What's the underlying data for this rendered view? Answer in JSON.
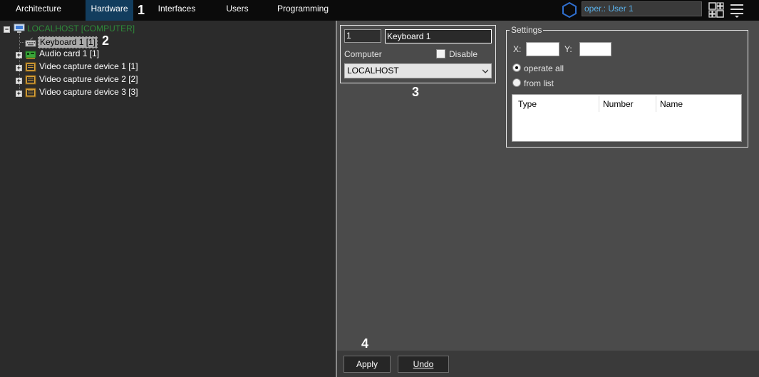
{
  "topbar": {
    "tabs": [
      {
        "label": "Architecture",
        "active": false
      },
      {
        "label": "Hardware",
        "active": true
      },
      {
        "label": "Interfaces",
        "active": false
      },
      {
        "label": "Users",
        "active": false
      },
      {
        "label": "Programming",
        "active": false
      }
    ],
    "user_field": "oper.: User 1",
    "icons": [
      "hexagon-icon",
      "layout-grid-icon",
      "menu-icon"
    ]
  },
  "markers": [
    "1",
    "2",
    "3",
    "4"
  ],
  "tree": {
    "root": "LOCALHOST [COMPUTER]",
    "items": [
      {
        "label": "Keyboard 1 [1]",
        "icon": "keyboard-icon",
        "selected": true
      },
      {
        "label": "Audio card 1 [1]",
        "icon": "audio-card-icon",
        "selected": false
      },
      {
        "label": "Video capture device 1 [1]",
        "icon": "video-capture-icon",
        "selected": false
      },
      {
        "label": "Video capture device 2 [2]",
        "icon": "video-capture-icon",
        "selected": false
      },
      {
        "label": "Video capture device 3 [3]",
        "icon": "video-capture-icon",
        "selected": false
      }
    ]
  },
  "device": {
    "number": "1",
    "name": "Keyboard 1",
    "computer_label": "Computer",
    "disable_label": "Disable",
    "disable_checked": false,
    "computer_value": "LOCALHOST"
  },
  "settings": {
    "legend": "Settings",
    "x_label": "X:",
    "y_label": "Y:",
    "x_value": "",
    "y_value": "",
    "radio_operate_all": "operate all",
    "radio_from_list": "from list",
    "selected_radio": "operate all",
    "columns": [
      "Type",
      "Number",
      "Name"
    ]
  },
  "actions": {
    "apply": "Apply",
    "undo": "Undo"
  },
  "colors": {
    "topbar": "#0b0b0b",
    "active_tab": "#123d5e",
    "left_pane": "#2b2b2b",
    "right_pane": "#4b4b4b",
    "root_text": "#2e8b3a",
    "user_text": "#5ab1ea"
  }
}
